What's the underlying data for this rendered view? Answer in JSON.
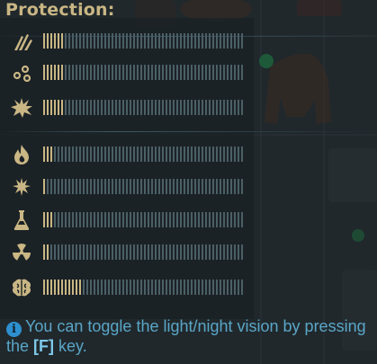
{
  "panel": {
    "title": "Protection:"
  },
  "protection_rows": [
    {
      "icon": "claw-slash-icon",
      "level": 0.1
    },
    {
      "icon": "bullet-holes-icon",
      "level": 0.1
    },
    {
      "icon": "explosion-icon",
      "level": 0.1
    },
    {
      "icon": "fire-icon",
      "level": 0.05
    },
    {
      "icon": "electric-shock-icon",
      "level": 0.02
    },
    {
      "icon": "chemical-flask-icon",
      "level": 0.05
    },
    {
      "icon": "radiation-icon",
      "level": 0.03
    },
    {
      "icon": "brain-psi-icon",
      "level": 0.2
    }
  ],
  "info": {
    "text_before": "You can toggle the light/night vision by pressing the ",
    "key": "[F]",
    "text_after": " key."
  },
  "colors": {
    "accent_gold": "#c9b684",
    "tick_empty": "#4b5f66",
    "hint_blue": "#5aa6c7",
    "key_highlight": "#7fc9ea"
  }
}
